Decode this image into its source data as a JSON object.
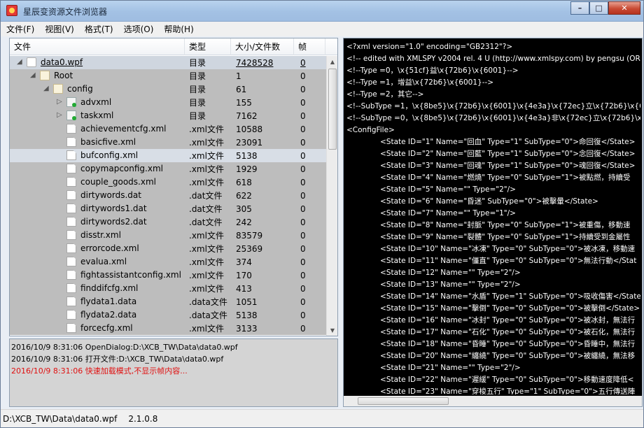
{
  "window": {
    "title": "星辰变资源文件浏览器",
    "min_label": "–",
    "max_label": "□",
    "close_label": "✕"
  },
  "menu": [
    "文件(F)",
    "视图(V)",
    "格式(T)",
    "选项(O)",
    "帮助(H)"
  ],
  "table": {
    "headers": [
      "文件",
      "类型",
      "大小/文件数",
      "帧"
    ],
    "rows": [
      {
        "name": "data0.wpf",
        "type": "目录",
        "size": "7428528",
        "frames": "0",
        "level": 0,
        "expand": "◢",
        "icon": "folder-root-icon"
      },
      {
        "name": "Root",
        "type": "目录",
        "size": "1",
        "frames": "0",
        "level": 1,
        "expand": "◢",
        "icon": "folder-icon"
      },
      {
        "name": "config",
        "type": "目录",
        "size": "61",
        "frames": "0",
        "level": 2,
        "expand": "◢",
        "icon": "folder-icon"
      },
      {
        "name": "advxml",
        "type": "目录",
        "size": "155",
        "frames": "0",
        "level": 3,
        "expand": "▷",
        "icon": "green-folder-icon"
      },
      {
        "name": "taskxml",
        "type": "目录",
        "size": "7162",
        "frames": "0",
        "level": 3,
        "expand": "▷",
        "icon": "green-folder-icon"
      },
      {
        "name": "achievementcfg.xml",
        ".type": "",
        "type": ".xml文件",
        "size": "10588",
        "frames": "0",
        "level": 3,
        "expand": "",
        "icon": "file-icon"
      },
      {
        "name": "basicfive.xml",
        "type": ".xml文件",
        "size": "23091",
        "frames": "0",
        "level": 3,
        "expand": "",
        "icon": "file-icon"
      },
      {
        "name": "bufconfig.xml",
        "type": ".xml文件",
        "size": "5138",
        "frames": "0",
        "level": 3,
        "expand": "",
        "icon": "file-icon",
        "selected": true
      },
      {
        "name": "copymapconfig.xml",
        "type": ".xml文件",
        "size": "1929",
        "frames": "0",
        "level": 3,
        "expand": "",
        "icon": "file-icon"
      },
      {
        "name": "couple_goods.xml",
        "type": ".xml文件",
        "size": "618",
        "frames": "0",
        "level": 3,
        "expand": "",
        "icon": "file-icon"
      },
      {
        "name": "dirtywords.dat",
        "type": ".dat文件",
        "size": "622",
        "frames": "0",
        "level": 3,
        "expand": "",
        "icon": "file-icon"
      },
      {
        "name": "dirtywords1.dat",
        "type": ".dat文件",
        "size": "305",
        "frames": "0",
        "level": 3,
        "expand": "",
        "icon": "file-icon"
      },
      {
        "name": "dirtywords2.dat",
        "type": ".dat文件",
        "size": "242",
        "frames": "0",
        "level": 3,
        "expand": "",
        "icon": "file-icon"
      },
      {
        "name": "disstr.xml",
        "type": ".xml文件",
        "size": "83579",
        "frames": "0",
        "level": 3,
        "expand": "",
        "icon": "file-icon"
      },
      {
        "name": "errorcode.xml",
        "type": ".xml文件",
        "size": "25369",
        "frames": "0",
        "level": 3,
        "expand": "",
        "icon": "file-icon"
      },
      {
        "name": "evalua.xml",
        "type": ".xml文件",
        "size": "374",
        "frames": "0",
        "level": 3,
        "expand": "",
        "icon": "file-icon"
      },
      {
        "name": "fightassistantconfig.xml",
        "type": ".xml文件",
        "size": "170",
        "frames": "0",
        "level": 3,
        "expand": "",
        "icon": "file-icon"
      },
      {
        "name": "finddifcfg.xml",
        "type": ".xml文件",
        "size": "413",
        "frames": "0",
        "level": 3,
        "expand": "",
        "icon": "file-icon"
      },
      {
        "name": "flydata1.data",
        "type": ".data文件",
        "size": "1051",
        "frames": "0",
        "level": 3,
        "expand": "",
        "icon": "file-icon"
      },
      {
        "name": "flydata2.data",
        "type": ".data文件",
        "size": "5138",
        "frames": "0",
        "level": 3,
        "expand": "",
        "icon": "file-icon"
      },
      {
        "name": "forcecfg.xml",
        "type": ".xml文件",
        "size": "3133",
        "frames": "0",
        "level": 3,
        "expand": "",
        "icon": "file-icon"
      }
    ]
  },
  "log": [
    {
      "text": "2016/10/9 8:31:06  OpenDialog:D:\\XCB_TW\\Data\\data0.wpf",
      "error": false
    },
    {
      "text": "2016/10/9 8:31:06  打开文件:D:\\XCB_TW\\Data\\data0.wpf",
      "error": false
    },
    {
      "text": "2016/10/9 8:31:06  快速加载模式,不显示帧内容...",
      "error": true
    }
  ],
  "xml_lines": [
    {
      "t": "<?xml version=\"1.0\" encoding=\"GB2312\"?>",
      "i": false
    },
    {
      "t": "<!-- edited with XMLSPY v2004 rel. 4 U (http://www.xmlspy.com) by pengsu (ORiC",
      "i": false
    },
    {
      "t": "<!--Type =0，\\x{51cf}益\\x{72b6}\\x{6001}-->",
      "i": false
    },
    {
      "t": "<!--Type =1，增益\\x{72b6}\\x{6001}-->",
      "i": false
    },
    {
      "t": "<!--Type =2，其它-->",
      "i": false
    },
    {
      "t": "<!--SubType =1，\\x{8be5}\\x{72b6}\\x{6001}\\x{4e3a}\\x{72ec}立\\x{72b6}\\x{600",
      "i": false
    },
    {
      "t": "<!--SubType =0，\\x{8be5}\\x{72b6}\\x{6001}\\x{4e3a}非\\x{72ec}立\\x{72b6}\\x{6",
      "i": false
    },
    {
      "t": "<ConfigFile>",
      "i": false
    },
    {
      "t": "<State ID=\"1\" Name=\"回血\" Type=\"1\" SubType=\"0\">命回復</State>",
      "i": true
    },
    {
      "t": "<State ID=\"2\" Name=\"回藍\" Type=\"1\" SubType=\"0\">念回復</State>",
      "i": true
    },
    {
      "t": "<State ID=\"3\" Name=\"回魂\" Type=\"1\" SubType=\"0\">魂回復</State>",
      "i": true
    },
    {
      "t": "<State ID=\"4\" Name=\"燃燒\" Type=\"0\" SubType=\"1\">被點燃，持續受",
      "i": true
    },
    {
      "t": "<State ID=\"5\" Name=\"\" Type=\"2\"/>",
      "i": true
    },
    {
      "t": "<State ID=\"6\" Name=\"昏迷\" SubType=\"0\">被擊暈</State>",
      "i": true
    },
    {
      "t": "<State ID=\"7\" Name=\"\" Type=\"1\"/>",
      "i": true
    },
    {
      "t": "<State ID=\"8\" Name=\"封脈\" Type=\"0\" SubType=\"1\">被重傷，移動速",
      "i": true
    },
    {
      "t": "<State ID=\"9\" Name=\"裂體\" Type=\"0\" SubType=\"1\">持續受到金屬性",
      "i": true
    },
    {
      "t": "<State ID=\"10\" Name=\"冰凍\" Type=\"0\" SubType=\"0\">被冰凍，移動速",
      "i": true
    },
    {
      "t": "<State ID=\"11\" Name=\"僵直\" Type=\"0\" SubType=\"0\">無法行動</Stat",
      "i": true
    },
    {
      "t": "<State ID=\"12\" Name=\"\" Type=\"2\"/>",
      "i": true
    },
    {
      "t": "<State ID=\"13\" Name=\"\" Type=\"2\"/>",
      "i": true
    },
    {
      "t": "<State ID=\"14\" Name=\"水盾\" Type=\"1\" SubType=\"0\">吸收傷害</State",
      "i": true
    },
    {
      "t": "<State ID=\"15\" Name=\"擊倒\" Type=\"0\" SubType=\"0\">被擊倒</State>",
      "i": true
    },
    {
      "t": "<State ID=\"16\" Name=\"冰封\" Type=\"0\" SubType=\"0\">被冰封，無法行",
      "i": true
    },
    {
      "t": "<State ID=\"17\" Name=\"石化\" Type=\"0\" SubType=\"0\">被石化，無法行",
      "i": true
    },
    {
      "t": "<State ID=\"18\" Name=\"昏睡\" Type=\"0\" SubType=\"0\">昏睡中，無法行",
      "i": true
    },
    {
      "t": "<State ID=\"20\" Name=\"纏繞\" Type=\"0\" SubType=\"0\">被纏繞，無法移",
      "i": true
    },
    {
      "t": "<State ID=\"21\" Name=\"\" Type=\"2\"/>",
      "i": true
    },
    {
      "t": "<State ID=\"22\" Name=\"遲緩\" Type=\"0\" SubType=\"0\">移動速度降低<",
      "i": true
    },
    {
      "t": "<State ID=\"23\" Name=\"穿梭五行\" Type=\"1\" SubType=\"0\">五行傳送陣",
      "i": true
    }
  ],
  "status": {
    "path": "D:\\XCB_TW\\Data\\data0.wpf",
    "version": "2.1.0.8"
  }
}
